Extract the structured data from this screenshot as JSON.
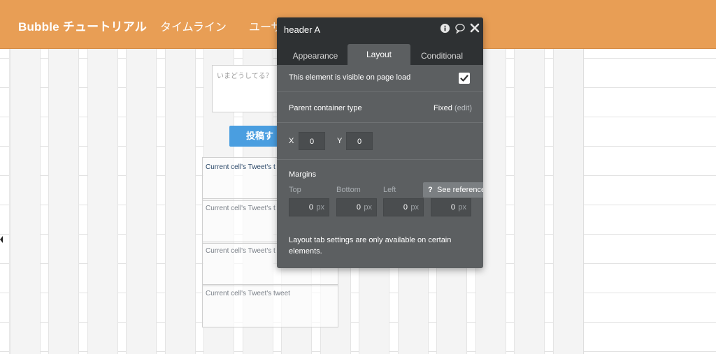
{
  "header": {
    "brand": "Bubble チュートリアル",
    "nav": [
      "タイムライン",
      "ユーザ"
    ]
  },
  "page": {
    "textarea_placeholder": "いまどうしてる？",
    "post_button_label": "投稿す",
    "cells": [
      "Current cell's Tweet's t",
      "Current cell's Tweet's t",
      "Current cell's Tweet's t",
      "Current cell's Tweet's tweet"
    ]
  },
  "panel": {
    "title": "header A",
    "icons": [
      "info-icon",
      "comment-icon",
      "close-icon"
    ],
    "tabs": [
      "Appearance",
      "Layout",
      "Conditional"
    ],
    "active_tab": "Layout",
    "visible_label": "This element is visible on page load",
    "visible_checked": true,
    "parent_label": "Parent container type",
    "parent_value": "Fixed",
    "parent_edit": "(edit)",
    "x_label": "X",
    "x_value": "0",
    "y_label": "Y",
    "y_value": "0",
    "margins_label": "Margins",
    "margin_labels": [
      "Top",
      "Bottom",
      "Left"
    ],
    "margin_values": [
      "0",
      "0",
      "0",
      "0"
    ],
    "margin_unit": "px",
    "reference_q": "?",
    "reference_label": "See reference →",
    "note": "Layout tab settings are only available on certain elements."
  },
  "colors": {
    "header_bg": "#e89e55",
    "panel_bg": "#5c5f61",
    "panel_head_bg": "#2e3133",
    "button_blue": "#4a9ee0"
  }
}
